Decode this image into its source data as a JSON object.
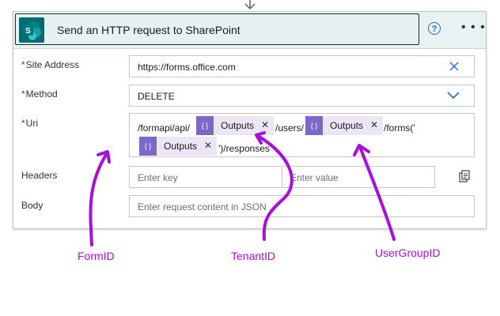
{
  "header": {
    "title": "Send an HTTP request to SharePoint"
  },
  "icons": {
    "app": "sharepoint-icon",
    "help": "help-icon",
    "more": "more-icon"
  },
  "fields": {
    "site_address": {
      "label": "Site Address",
      "required": true,
      "value": "https://forms.office.com"
    },
    "method": {
      "label": "Method",
      "required": true,
      "value": "DELETE"
    },
    "uri": {
      "label": "Uri",
      "required": true,
      "segments": {
        "s1": "/formapi/api/",
        "token1": "Outputs",
        "s2": "/users/",
        "token2": "Outputs",
        "s3": "/forms('",
        "token3": "Outputs",
        "s4": "')/responses"
      }
    },
    "headers": {
      "label": "Headers",
      "key_placeholder": "Enter key",
      "value_placeholder": "Enter value"
    },
    "body": {
      "label": "Body",
      "placeholder": "Enter request content in JSON"
    }
  },
  "annotations": {
    "form_id": "FormID",
    "tenant_id": "TenantID",
    "user_group_id": "UserGroupID"
  },
  "colors": {
    "annotation": "#a80fdd",
    "token_icon": "#7b68c8",
    "sharepoint": "#036c70",
    "accent": "#2266e3"
  }
}
